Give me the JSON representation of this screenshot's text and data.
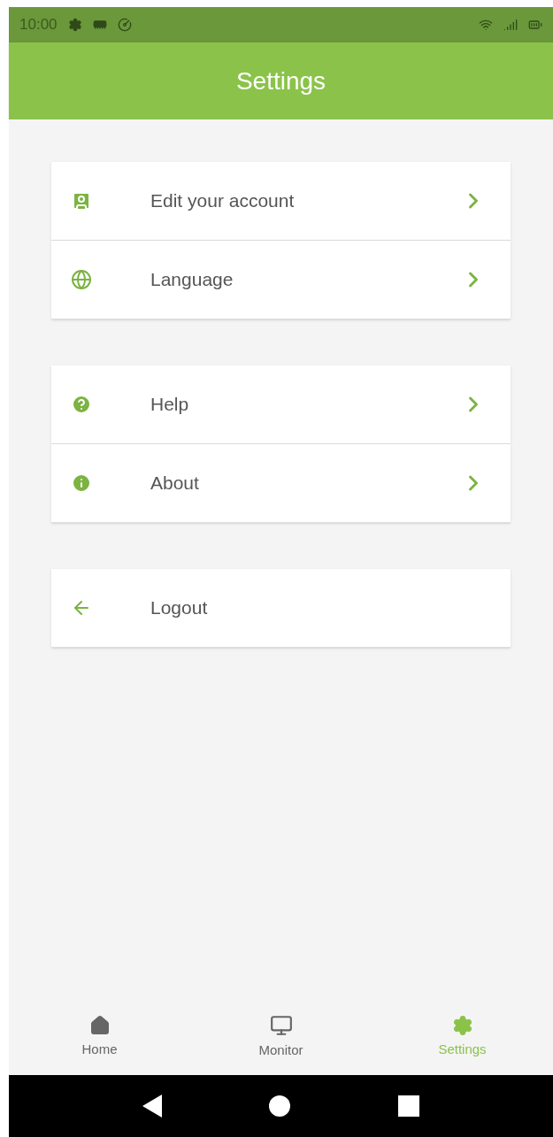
{
  "status_bar": {
    "time": "10:00"
  },
  "header": {
    "title": "Settings"
  },
  "groups": [
    {
      "items": [
        {
          "kind": "account",
          "label": "Edit your account",
          "chevron": true
        },
        {
          "kind": "language",
          "label": "Language",
          "chevron": true
        }
      ]
    },
    {
      "items": [
        {
          "kind": "help",
          "label": "Help",
          "chevron": true
        },
        {
          "kind": "about",
          "label": "About",
          "chevron": true
        }
      ]
    },
    {
      "items": [
        {
          "kind": "logout",
          "label": "Logout",
          "chevron": false
        }
      ]
    }
  ],
  "bottom_nav": [
    {
      "kind": "home",
      "label": "Home",
      "selected": false
    },
    {
      "kind": "monitor",
      "label": "Monitor",
      "selected": false
    },
    {
      "kind": "settings",
      "label": "Settings",
      "selected": true
    }
  ]
}
